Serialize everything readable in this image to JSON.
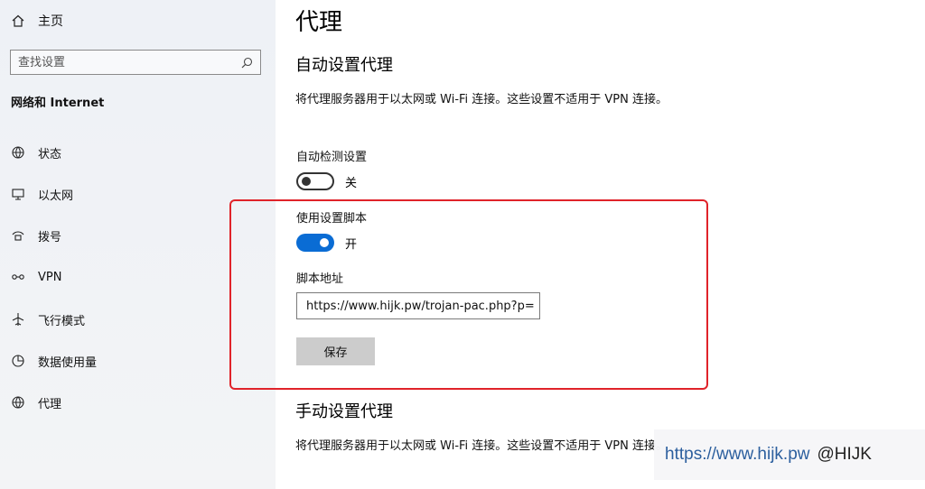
{
  "sidebar": {
    "home_label": "主页",
    "search_placeholder": "查找设置",
    "section_title": "网络和 Internet",
    "items": [
      {
        "label": "状态",
        "icon": "status-globe-icon"
      },
      {
        "label": "以太网",
        "icon": "ethernet-icon"
      },
      {
        "label": "拨号",
        "icon": "dialup-icon"
      },
      {
        "label": "VPN",
        "icon": "vpn-icon"
      },
      {
        "label": "飞行模式",
        "icon": "airplane-icon"
      },
      {
        "label": "数据使用量",
        "icon": "data-usage-icon"
      },
      {
        "label": "代理",
        "icon": "proxy-globe-icon"
      }
    ]
  },
  "main": {
    "title": "代理",
    "auto_section": {
      "heading": "自动设置代理",
      "description": "将代理服务器用于以太网或 Wi-Fi 连接。这些设置不适用于 VPN 连接。",
      "auto_detect": {
        "label": "自动检测设置",
        "state_label": "关",
        "on": false
      },
      "use_script": {
        "label": "使用设置脚本",
        "state_label": "开",
        "on": true
      },
      "script_address": {
        "label": "脚本地址",
        "value": "https://www.hijk.pw/trojan-pac.php?p="
      },
      "save_label": "保存"
    },
    "manual_section": {
      "heading": "手动设置代理",
      "description": "将代理服务器用于以太网或 Wi-Fi 连接。这些设置不适用于 VPN 连接。"
    }
  },
  "watermark": {
    "url": "https://www.hijk.pw",
    "tag": "@HIJK"
  },
  "colors": {
    "accent": "#0a6cd4",
    "highlight_border": "#e0232a"
  }
}
